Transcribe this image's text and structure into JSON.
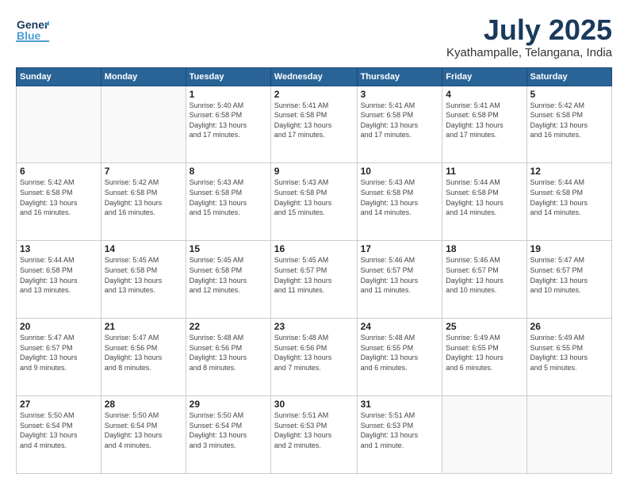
{
  "header": {
    "logo_line1": "General",
    "logo_line2": "Blue",
    "month": "July 2025",
    "location": "Kyathampalle, Telangana, India"
  },
  "weekdays": [
    "Sunday",
    "Monday",
    "Tuesday",
    "Wednesday",
    "Thursday",
    "Friday",
    "Saturday"
  ],
  "weeks": [
    [
      {
        "day": "",
        "info": ""
      },
      {
        "day": "",
        "info": ""
      },
      {
        "day": "1",
        "info": "Sunrise: 5:40 AM\nSunset: 6:58 PM\nDaylight: 13 hours\nand 17 minutes."
      },
      {
        "day": "2",
        "info": "Sunrise: 5:41 AM\nSunset: 6:58 PM\nDaylight: 13 hours\nand 17 minutes."
      },
      {
        "day": "3",
        "info": "Sunrise: 5:41 AM\nSunset: 6:58 PM\nDaylight: 13 hours\nand 17 minutes."
      },
      {
        "day": "4",
        "info": "Sunrise: 5:41 AM\nSunset: 6:58 PM\nDaylight: 13 hours\nand 17 minutes."
      },
      {
        "day": "5",
        "info": "Sunrise: 5:42 AM\nSunset: 6:58 PM\nDaylight: 13 hours\nand 16 minutes."
      }
    ],
    [
      {
        "day": "6",
        "info": "Sunrise: 5:42 AM\nSunset: 6:58 PM\nDaylight: 13 hours\nand 16 minutes."
      },
      {
        "day": "7",
        "info": "Sunrise: 5:42 AM\nSunset: 6:58 PM\nDaylight: 13 hours\nand 16 minutes."
      },
      {
        "day": "8",
        "info": "Sunrise: 5:43 AM\nSunset: 6:58 PM\nDaylight: 13 hours\nand 15 minutes."
      },
      {
        "day": "9",
        "info": "Sunrise: 5:43 AM\nSunset: 6:58 PM\nDaylight: 13 hours\nand 15 minutes."
      },
      {
        "day": "10",
        "info": "Sunrise: 5:43 AM\nSunset: 6:58 PM\nDaylight: 13 hours\nand 14 minutes."
      },
      {
        "day": "11",
        "info": "Sunrise: 5:44 AM\nSunset: 6:58 PM\nDaylight: 13 hours\nand 14 minutes."
      },
      {
        "day": "12",
        "info": "Sunrise: 5:44 AM\nSunset: 6:58 PM\nDaylight: 13 hours\nand 14 minutes."
      }
    ],
    [
      {
        "day": "13",
        "info": "Sunrise: 5:44 AM\nSunset: 6:58 PM\nDaylight: 13 hours\nand 13 minutes."
      },
      {
        "day": "14",
        "info": "Sunrise: 5:45 AM\nSunset: 6:58 PM\nDaylight: 13 hours\nand 13 minutes."
      },
      {
        "day": "15",
        "info": "Sunrise: 5:45 AM\nSunset: 6:58 PM\nDaylight: 13 hours\nand 12 minutes."
      },
      {
        "day": "16",
        "info": "Sunrise: 5:45 AM\nSunset: 6:57 PM\nDaylight: 13 hours\nand 11 minutes."
      },
      {
        "day": "17",
        "info": "Sunrise: 5:46 AM\nSunset: 6:57 PM\nDaylight: 13 hours\nand 11 minutes."
      },
      {
        "day": "18",
        "info": "Sunrise: 5:46 AM\nSunset: 6:57 PM\nDaylight: 13 hours\nand 10 minutes."
      },
      {
        "day": "19",
        "info": "Sunrise: 5:47 AM\nSunset: 6:57 PM\nDaylight: 13 hours\nand 10 minutes."
      }
    ],
    [
      {
        "day": "20",
        "info": "Sunrise: 5:47 AM\nSunset: 6:57 PM\nDaylight: 13 hours\nand 9 minutes."
      },
      {
        "day": "21",
        "info": "Sunrise: 5:47 AM\nSunset: 6:56 PM\nDaylight: 13 hours\nand 8 minutes."
      },
      {
        "day": "22",
        "info": "Sunrise: 5:48 AM\nSunset: 6:56 PM\nDaylight: 13 hours\nand 8 minutes."
      },
      {
        "day": "23",
        "info": "Sunrise: 5:48 AM\nSunset: 6:56 PM\nDaylight: 13 hours\nand 7 minutes."
      },
      {
        "day": "24",
        "info": "Sunrise: 5:48 AM\nSunset: 6:55 PM\nDaylight: 13 hours\nand 6 minutes."
      },
      {
        "day": "25",
        "info": "Sunrise: 5:49 AM\nSunset: 6:55 PM\nDaylight: 13 hours\nand 6 minutes."
      },
      {
        "day": "26",
        "info": "Sunrise: 5:49 AM\nSunset: 6:55 PM\nDaylight: 13 hours\nand 5 minutes."
      }
    ],
    [
      {
        "day": "27",
        "info": "Sunrise: 5:50 AM\nSunset: 6:54 PM\nDaylight: 13 hours\nand 4 minutes."
      },
      {
        "day": "28",
        "info": "Sunrise: 5:50 AM\nSunset: 6:54 PM\nDaylight: 13 hours\nand 4 minutes."
      },
      {
        "day": "29",
        "info": "Sunrise: 5:50 AM\nSunset: 6:54 PM\nDaylight: 13 hours\nand 3 minutes."
      },
      {
        "day": "30",
        "info": "Sunrise: 5:51 AM\nSunset: 6:53 PM\nDaylight: 13 hours\nand 2 minutes."
      },
      {
        "day": "31",
        "info": "Sunrise: 5:51 AM\nSunset: 6:53 PM\nDaylight: 13 hours\nand 1 minute."
      },
      {
        "day": "",
        "info": ""
      },
      {
        "day": "",
        "info": ""
      }
    ]
  ]
}
